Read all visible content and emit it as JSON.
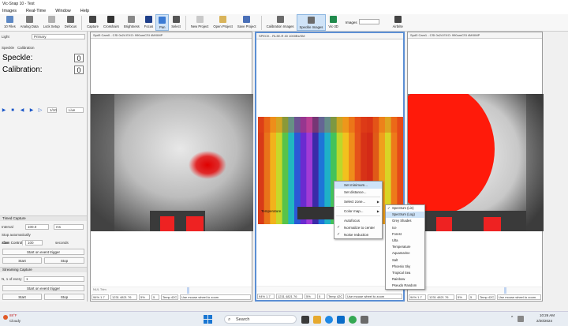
{
  "window": {
    "title": "Vic-Snap 10 - Test"
  },
  "menu": [
    "Images",
    "Real-Time",
    "Window",
    "Help"
  ],
  "toolbar": {
    "items": [
      {
        "label": "10 Files",
        "color": "#5d88c4"
      },
      {
        "label": "Analog Data",
        "color": "#7a7a7a"
      },
      {
        "label": "Lock Setup",
        "color": "#b0b0b0"
      },
      {
        "label": "Defocus",
        "color": "#666666"
      },
      {
        "label": "Capture",
        "color": "#444444"
      },
      {
        "label": "Crosshairs",
        "color": "#333333"
      },
      {
        "label": "Brightness",
        "color": "#888888"
      },
      {
        "label": "Focus",
        "color": "#1f3f8a"
      },
      {
        "label": "Pan",
        "color": "#3b7bd4",
        "active": true
      },
      {
        "label": "Select",
        "color": "#555555"
      },
      {
        "label": "New Project",
        "color": "#c9c9c9"
      },
      {
        "label": "Open Project",
        "color": "#d9b45a"
      },
      {
        "label": "Save Project",
        "color": "#4a70b8"
      },
      {
        "label": "Calibration Images",
        "color": "#6b6b6b"
      },
      {
        "label": "Speckle Images",
        "color": "#6b6b6b",
        "active": true
      },
      {
        "label": "Vic-3D",
        "color": "#1f8a4c"
      }
    ],
    "images_label": "Images",
    "images_value": "",
    "extra_label": "Airbrite"
  },
  "left_panel": {
    "header_left": "Light",
    "header_value": "Primary",
    "tabs": [
      "Speckle",
      "Calibration"
    ],
    "speckle_label": "Speckle:",
    "speckle_value": "0",
    "calibration_label": "Calibration:",
    "calibration_value": "0",
    "playback_buttons": [
      "▶",
      "■",
      "◀",
      "▶",
      "▷"
    ],
    "frame_value": "1/10",
    "speed_value": "Live",
    "section_tabs": [
      "Cam Control",
      "Project"
    ],
    "capture_section": "Timed Capture",
    "interval_label": "Interval",
    "interval_value": "100.0",
    "interval_unit": "ms",
    "auto_label": "Stop automatically",
    "after_label": "after",
    "after_value": "100",
    "after_unit": "seconds",
    "event_button": "Start on event trigger",
    "start_button": "Start",
    "stop_button": "Stop",
    "streaming_section": "Streaming Capture",
    "every_label": "N, 1 of every",
    "every_value": "1",
    "event_button_2": "Start on event trigger",
    "start_button_2": "Start",
    "stop_button_2": "Stop"
  },
  "panes": [
    {
      "header": "Spd3 Cam0 - CSI 0x24 EXO: 990umCSI 4MXIMP",
      "footer_label": "NUL Trim",
      "status": [
        "94% 1.7",
        "1231 4821 76",
        "5%",
        "5",
        "Temp 42C",
        "Use mouse wheel to zoom"
      ]
    },
    {
      "header": "SPECK - RL3E-R 40 1000BUSM",
      "footer_label": "",
      "status": [
        "94% 1.7",
        "1231 4821 76",
        "5%",
        "5",
        "Temp 42C",
        "Use mouse wheel to zoom"
      ]
    },
    {
      "header": "Spd3 Cam1 - CSI 0x24 EXO: 990umCSI 4MXIMP",
      "footer_label": "",
      "status": [
        "94% 1.7",
        "1231 4821 76",
        "5%",
        "5",
        "Temp 42C",
        "Use mouse wheel to zoom"
      ]
    }
  ],
  "overlay_label": "Temperature",
  "context_menu": {
    "items": [
      {
        "label": "Set minimum...",
        "highlight": true
      },
      {
        "label": "Set distance..."
      },
      {
        "sep": true
      },
      {
        "label": "Select zone...",
        "arrow": true
      },
      {
        "sep": true
      },
      {
        "label": "Color map...",
        "arrow": true
      },
      {
        "sep": true
      },
      {
        "label": "Autofocus"
      },
      {
        "label": "Normalize to center",
        "check": true
      },
      {
        "label": "Noise reduction",
        "check": true
      }
    ]
  },
  "colormap_menu": {
    "items": [
      {
        "label": "Spectrum (Lin)",
        "check": true
      },
      {
        "label": "Spectrum (Log)",
        "highlight": true
      },
      {
        "label": "Grey Shades"
      },
      {
        "label": "Ice"
      },
      {
        "label": "Forest"
      },
      {
        "label": "Ulta"
      },
      {
        "label": "Temperature"
      },
      {
        "label": "Aquamarine"
      },
      {
        "label": "Salt"
      },
      {
        "label": "Phoenix Sky"
      },
      {
        "label": "Tropical Sea"
      },
      {
        "label": "Rainbow"
      },
      {
        "label": "Pseudo Random"
      }
    ]
  },
  "taskbar": {
    "weather_temp": "88°F",
    "weather_desc": "Cloudy",
    "search_placeholder": "Search",
    "time": "10:26 AM",
    "date": "2/20/2024"
  }
}
